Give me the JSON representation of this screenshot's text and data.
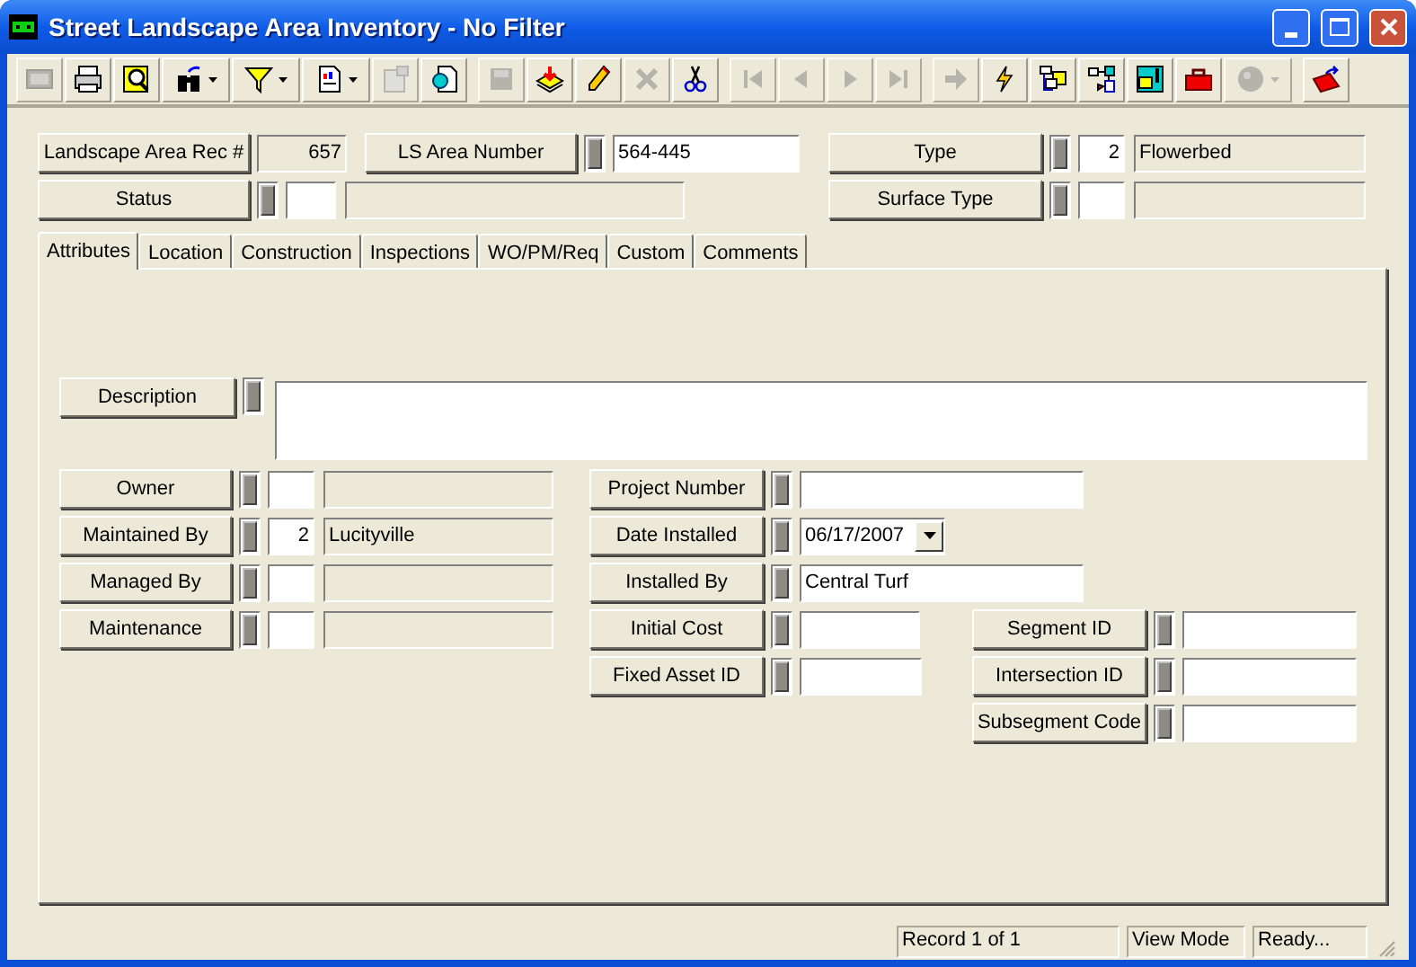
{
  "window": {
    "title": "Street Landscape Area Inventory - No Filter"
  },
  "toolbar": {
    "groups": [
      {
        "buttons": [
          {
            "kind": "plain",
            "disabled": true
          },
          {
            "kind": "plain",
            "disabled": false
          },
          {
            "kind": "plain",
            "disabled": false
          },
          {
            "kind": "split",
            "disabled": false
          },
          {
            "kind": "split",
            "disabled": false
          },
          {
            "kind": "split",
            "disabled": false
          },
          {
            "kind": "plain",
            "disabled": true
          },
          {
            "kind": "plain",
            "disabled": false
          }
        ]
      },
      {
        "buttons": [
          {
            "kind": "plain",
            "disabled": true
          },
          {
            "kind": "plain",
            "disabled": false
          },
          {
            "kind": "plain",
            "disabled": false
          },
          {
            "kind": "plain",
            "disabled": true
          },
          {
            "kind": "plain",
            "disabled": false
          }
        ]
      },
      {
        "buttons": [
          {
            "kind": "plain",
            "disabled": true
          },
          {
            "kind": "plain",
            "disabled": true
          },
          {
            "kind": "plain",
            "disabled": true
          },
          {
            "kind": "plain",
            "disabled": true
          }
        ]
      },
      {
        "buttons": [
          {
            "kind": "plain",
            "disabled": true
          },
          {
            "kind": "plain",
            "disabled": false
          },
          {
            "kind": "plain",
            "disabled": false
          },
          {
            "kind": "plain",
            "disabled": false
          },
          {
            "kind": "plain",
            "disabled": false
          },
          {
            "kind": "plain",
            "disabled": false
          },
          {
            "kind": "split",
            "disabled": true
          }
        ]
      },
      {
        "buttons": [
          {
            "kind": "plain",
            "disabled": false
          }
        ]
      }
    ]
  },
  "header": [
    {
      "kind": "readonly",
      "label": "Landscape Area Rec #",
      "value": "657"
    },
    {
      "kind": "text",
      "label": "LS Area Number",
      "value": "564-445"
    },
    {
      "kind": "lookup",
      "label": "Type",
      "code": "2",
      "value": "Flowerbed"
    },
    {
      "kind": "lookup",
      "label": "Status"
    },
    {
      "kind": "lookup",
      "label": "Surface Type"
    }
  ],
  "tabs": [
    {
      "label": "Attributes",
      "selected": true
    },
    {
      "label": "Location",
      "selected": false
    },
    {
      "label": "Construction",
      "selected": false
    },
    {
      "label": "Inspections",
      "selected": false
    },
    {
      "label": "WO/PM/Req",
      "selected": false
    },
    {
      "label": "Custom",
      "selected": false
    },
    {
      "label": "Comments",
      "selected": false
    }
  ],
  "attributes": {
    "description": {
      "kind": "memo",
      "label": "Description"
    },
    "left": [
      {
        "kind": "lookup",
        "label": "Owner"
      },
      {
        "kind": "lookup",
        "label": "Maintained By",
        "code": "2",
        "value": "Lucityville"
      },
      {
        "kind": "lookup",
        "label": "Managed By"
      },
      {
        "kind": "lookup",
        "label": "Maintenance"
      }
    ],
    "middle": [
      {
        "kind": "text",
        "label": "Project Number"
      },
      {
        "kind": "date",
        "label": "Date Installed",
        "value": "06/17/2007"
      },
      {
        "kind": "text",
        "label": "Installed By",
        "value": "Central Turf"
      },
      {
        "kind": "text",
        "label": "Initial Cost"
      },
      {
        "kind": "text",
        "label": "Fixed Asset ID"
      }
    ],
    "right": [
      {
        "kind": "text",
        "label": "Segment ID"
      },
      {
        "kind": "text",
        "label": "Intersection ID"
      },
      {
        "kind": "text",
        "label": "Subsegment Code"
      }
    ]
  },
  "status_bar": [
    "Record 1 of 1",
    "View Mode",
    "Ready..."
  ]
}
